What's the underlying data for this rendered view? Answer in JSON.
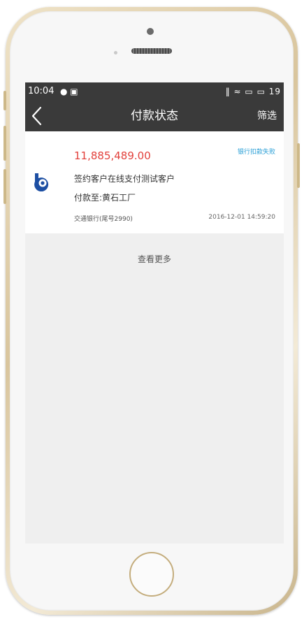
{
  "status_bar": {
    "time": "10:04",
    "left_icons": "● ▣",
    "right_icons": "‖ ≈ ▭ ▭ 19"
  },
  "nav": {
    "back_glyph": "<",
    "title": "付款状态",
    "filter_label": "筛选"
  },
  "payment": {
    "amount": "11,885,489.00",
    "status": "银行扣款失败",
    "customer": "签约客户在线支付测试客户",
    "payee": "付款至:黄石工厂",
    "bank": "交通银行(尾号2990)",
    "datetime": "2016-12-01 14:59:20"
  },
  "more_label": "查看更多",
  "colors": {
    "header_bg": "#3a3a3a",
    "amount": "#e2403b",
    "status_badge": "#2a9fd6",
    "bank_logo": "#1d4fa3"
  },
  "icons": {
    "bank_logo": "bank-of-communications-logo-icon",
    "back": "chevron-left-icon"
  }
}
